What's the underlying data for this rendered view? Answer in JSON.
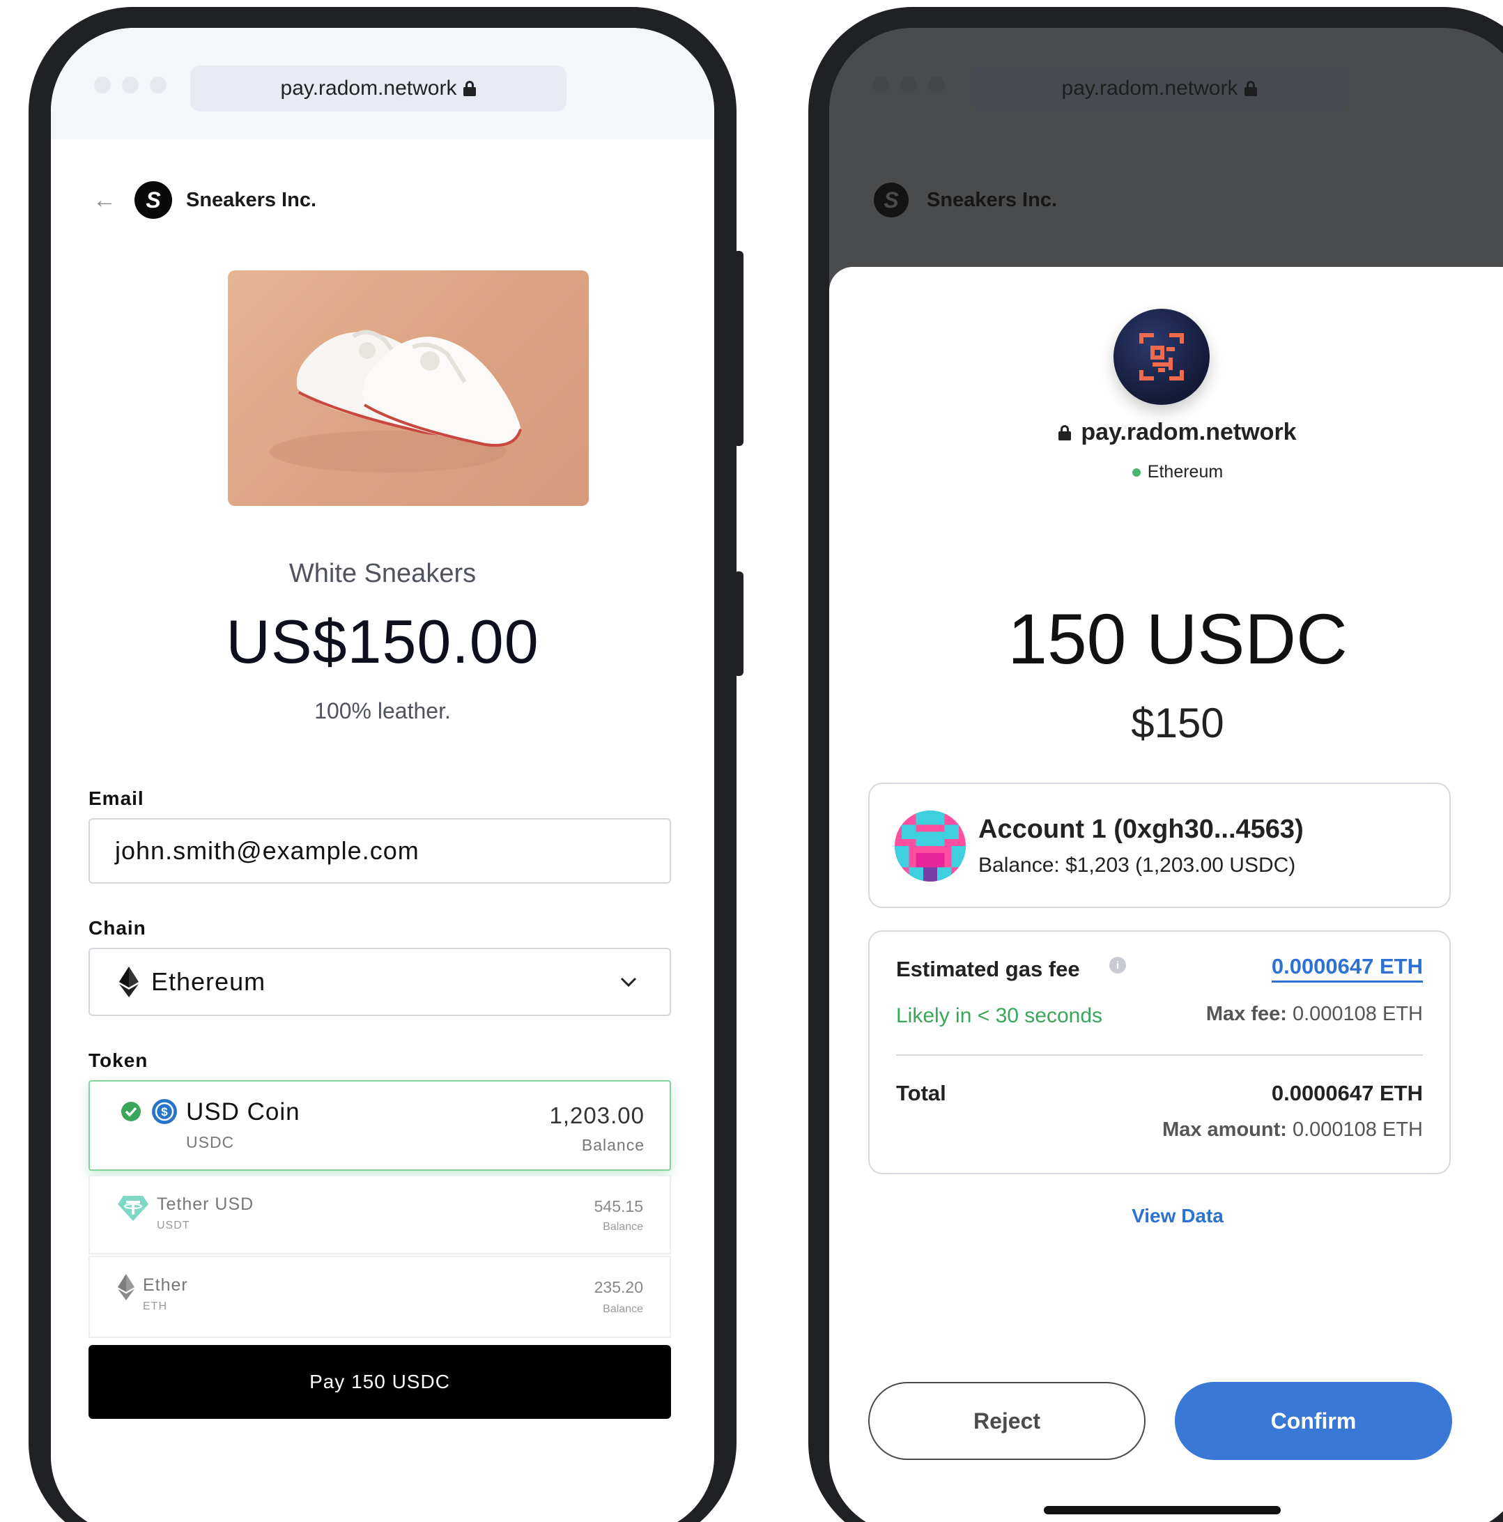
{
  "browser": {
    "url": "pay.radom.network"
  },
  "merchant": {
    "name": "Sneakers Inc.",
    "logo_letter": "S"
  },
  "product": {
    "title": "White Sneakers",
    "price": "US$150.00",
    "description": "100% leather."
  },
  "form": {
    "email_label": "Email",
    "email_value": "john.smith@example.com",
    "chain_label": "Chain",
    "chain_value": "Ethereum",
    "token_label": "Token",
    "tokens": [
      {
        "name": "USD Coin",
        "symbol": "USDC",
        "balance": "1,203.00",
        "balance_label": "Balance",
        "selected": true
      },
      {
        "name": "Tether USD",
        "symbol": "USDT",
        "balance": "545.15",
        "balance_label": "Balance",
        "selected": false
      },
      {
        "name": "Ether",
        "symbol": "ETH",
        "balance": "235.20",
        "balance_label": "Balance",
        "selected": false
      }
    ],
    "pay_button": "Pay 150 USDC"
  },
  "wallet": {
    "site": "pay.radom.network",
    "network": "Ethereum",
    "amount": "150 USDC",
    "fiat": "$150",
    "account": {
      "name": "Account 1 (0xgh30...4563)",
      "balance": "Balance: $1,203 (1,203.00 USDC)"
    },
    "gas": {
      "label": "Estimated gas fee",
      "value": "0.0000647 ETH",
      "speed": "Likely in < 30 seconds",
      "max_fee_label": "Max fee:",
      "max_fee_value": "0.000108 ETH"
    },
    "total": {
      "label": "Total",
      "value": "0.0000647 ETH",
      "max_amount_label": "Max amount:",
      "max_amount_value": "0.000108 ETH"
    },
    "view_data": "View Data",
    "reject": "Reject",
    "confirm": "Confirm"
  },
  "colors": {
    "primary": "#3a78d7",
    "success": "#3aa65a",
    "link": "#2d72d2",
    "selected_border": "#7fd49a"
  }
}
